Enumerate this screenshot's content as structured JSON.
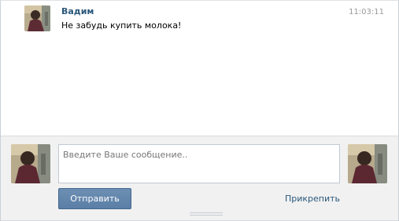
{
  "history": {
    "messages": [
      {
        "author": "Вадим",
        "time": "11:03:11",
        "text": "Не забудь купить молока!",
        "avatar_icon": "user-photo-icon"
      }
    ]
  },
  "compose": {
    "placeholder": "Введите Ваше сообщение..",
    "value": "",
    "send_label": "Отправить",
    "attach_label": "Прикрепить",
    "left_avatar_icon": "user-photo-icon",
    "right_avatar_icon": "user-photo-icon"
  },
  "colors": {
    "link": "#2b587a",
    "button": "#5e82a8",
    "panel": "#f1f1f1",
    "time": "#999999"
  }
}
